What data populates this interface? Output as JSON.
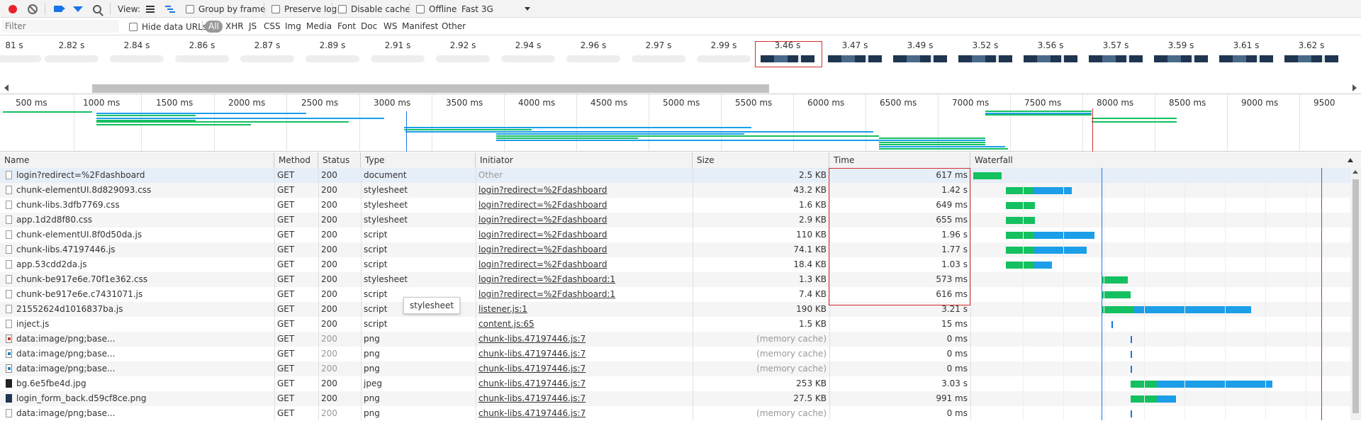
{
  "toolbar": {
    "view_label": "View:",
    "group_by_frame": "Group by frame",
    "preserve_log": "Preserve log",
    "disable_cache": "Disable cache",
    "offline": "Offline",
    "throttle": "Fast 3G"
  },
  "filter": {
    "placeholder": "Filter",
    "hide_data_urls": "Hide data URLs",
    "types": [
      "All",
      "XHR",
      "JS",
      "CSS",
      "Img",
      "Media",
      "Font",
      "Doc",
      "WS",
      "Manifest",
      "Other"
    ],
    "active": "All"
  },
  "frames": [
    "81 s",
    "2.82 s",
    "2.84 s",
    "2.86 s",
    "2.87 s",
    "2.89 s",
    "2.91 s",
    "2.92 s",
    "2.94 s",
    "2.96 s",
    "2.97 s",
    "2.99 s",
    "3.46 s",
    "3.47 s",
    "3.49 s",
    "3.52 s",
    "3.56 s",
    "3.57 s",
    "3.59 s",
    "3.61 s",
    "3.62 s"
  ],
  "overview": {
    "ticks": [
      "500 ms",
      "1000 ms",
      "1500 ms",
      "2000 ms",
      "2500 ms",
      "3000 ms",
      "3500 ms",
      "4000 ms",
      "4500 ms",
      "5000 ms",
      "5500 ms",
      "6000 ms",
      "6500 ms",
      "7000 ms",
      "7500 ms",
      "8000 ms",
      "8500 ms",
      "9000 ms",
      "9500"
    ]
  },
  "table": {
    "columns": {
      "name": "Name",
      "method": "Method",
      "status": "Status",
      "type": "Type",
      "initiator": "Initiator",
      "size": "Size",
      "time": "Time",
      "waterfall": "Waterfall"
    },
    "rows": [
      {
        "name": "login?redirect=%2Fdashboard",
        "method": "GET",
        "status": "200",
        "type": "document",
        "initiator": "Other",
        "size": "2.5 KB",
        "time": "617 ms"
      },
      {
        "name": "chunk-elementUI.8d829093.css",
        "method": "GET",
        "status": "200",
        "type": "stylesheet",
        "initiator": "login?redirect=%2Fdashboard",
        "size": "43.2 KB",
        "time": "1.42 s"
      },
      {
        "name": "chunk-libs.3dfb7769.css",
        "method": "GET",
        "status": "200",
        "type": "stylesheet",
        "initiator": "login?redirect=%2Fdashboard",
        "size": "1.6 KB",
        "time": "649 ms"
      },
      {
        "name": "app.1d2d8f80.css",
        "method": "GET",
        "status": "200",
        "type": "stylesheet",
        "initiator": "login?redirect=%2Fdashboard",
        "size": "2.9 KB",
        "time": "655 ms"
      },
      {
        "name": "chunk-elementUI.8f0d50da.js",
        "method": "GET",
        "status": "200",
        "type": "script",
        "initiator": "login?redirect=%2Fdashboard",
        "size": "110 KB",
        "time": "1.96 s"
      },
      {
        "name": "chunk-libs.47197446.js",
        "method": "GET",
        "status": "200",
        "type": "script",
        "initiator": "login?redirect=%2Fdashboard",
        "size": "74.1 KB",
        "time": "1.77 s"
      },
      {
        "name": "app.53cdd2da.js",
        "method": "GET",
        "status": "200",
        "type": "script",
        "initiator": "login?redirect=%2Fdashboard",
        "size": "18.4 KB",
        "time": "1.03 s"
      },
      {
        "name": "chunk-be917e6e.70f1e362.css",
        "method": "GET",
        "status": "200",
        "type": "stylesheet",
        "initiator": "login?redirect=%2Fdashboard:1",
        "size": "1.3 KB",
        "time": "573 ms"
      },
      {
        "name": "chunk-be917e6e.c7431071.js",
        "method": "GET",
        "status": "200",
        "type": "script",
        "initiator": "login?redirect=%2Fdashboard:1",
        "size": "7.4 KB",
        "time": "616 ms"
      },
      {
        "name": "21552624d1016837ba.js",
        "method": "GET",
        "status": "200",
        "type": "script",
        "initiator": "listener.js:1",
        "size": "190 KB",
        "time": "3.21 s"
      },
      {
        "name": "inject.js",
        "method": "GET",
        "status": "200",
        "type": "script",
        "initiator": "content.js:65",
        "size": "1.5 KB",
        "time": "15 ms"
      },
      {
        "name": "data:image/png;base...",
        "method": "GET",
        "status": "200",
        "type": "png",
        "initiator": "chunk-libs.47197446.js:7",
        "size": "(memory cache)",
        "time": "0 ms"
      },
      {
        "name": "data:image/png;base...",
        "method": "GET",
        "status": "200",
        "type": "png",
        "initiator": "chunk-libs.47197446.js:7",
        "size": "(memory cache)",
        "time": "0 ms"
      },
      {
        "name": "data:image/png;base...",
        "method": "GET",
        "status": "200",
        "type": "png",
        "initiator": "chunk-libs.47197446.js:7",
        "size": "(memory cache)",
        "time": "0 ms"
      },
      {
        "name": "bg.6e5fbe4d.jpg",
        "method": "GET",
        "status": "200",
        "type": "jpeg",
        "initiator": "chunk-libs.47197446.js:7",
        "size": "253 KB",
        "time": "3.03 s"
      },
      {
        "name": "login_form_back.d59cf8ce.png",
        "method": "GET",
        "status": "200",
        "type": "png",
        "initiator": "chunk-libs.47197446.js:7",
        "size": "27.5 KB",
        "time": "991 ms"
      },
      {
        "name": "data:image/png;base...",
        "method": "GET",
        "status": "200",
        "type": "png",
        "initiator": "chunk-libs.47197446.js:7",
        "size": "(memory cache)",
        "time": "0 ms"
      }
    ]
  },
  "tooltip": "stylesheet",
  "colors": {
    "waiting": "#14c060",
    "download": "#1c9ee8",
    "dom_line": "#1a73e8",
    "load_line": "#d32f2f",
    "highlight": "#d32f2f"
  }
}
